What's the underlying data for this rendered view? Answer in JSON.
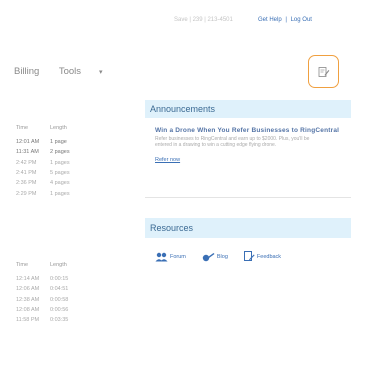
{
  "topbar": {
    "phone": "Save | 239 | 213-4501",
    "get_help": "Get Help",
    "separator": "|",
    "log_out": "Log Out"
  },
  "nav": {
    "billing": "Billing",
    "tools": "Tools",
    "tools_caret": "▾"
  },
  "calls_recent": {
    "headers": [
      "Time",
      "Length"
    ],
    "rows": [
      [
        "12:01 AM",
        "1 page"
      ],
      [
        "11:31 AM",
        "2 pages"
      ],
      [
        "2:42 PM",
        "1 pages"
      ],
      [
        "2:41 PM",
        "5 pages"
      ],
      [
        "2:36 PM",
        "4 pages"
      ],
      [
        "2:29 PM",
        "1 pages"
      ]
    ]
  },
  "calls_older": {
    "headers": [
      "Time",
      "Length"
    ],
    "rows": [
      [
        "12:14 AM",
        "0:00:15"
      ],
      [
        "12:06 AM",
        "0:04:51"
      ],
      [
        "12:38 AM",
        "0:00:58"
      ],
      [
        "12:08 AM",
        "0:00:56"
      ],
      [
        "11:58 PM",
        "0:03:35"
      ]
    ]
  },
  "announcements": {
    "heading": "Announcements",
    "title": "Win a Drone When You Refer Businesses to RingCentral",
    "desc": "Refer businesses to RingCentral and earn up to $2000. Plus, you'll be entered in a drawing to win a cutting edge flying drone.",
    "more": "Refer now"
  },
  "resources": {
    "heading": "Resources",
    "links": [
      {
        "label": "Forum",
        "icon": "forum-icon"
      },
      {
        "label": "Blog",
        "icon": "blog-icon"
      },
      {
        "label": "Feedback",
        "icon": "feedback-icon"
      }
    ]
  },
  "colors": {
    "accent_orange": "#f0a040",
    "panel_bg": "#dff1fb",
    "link": "#3a6fb5"
  }
}
